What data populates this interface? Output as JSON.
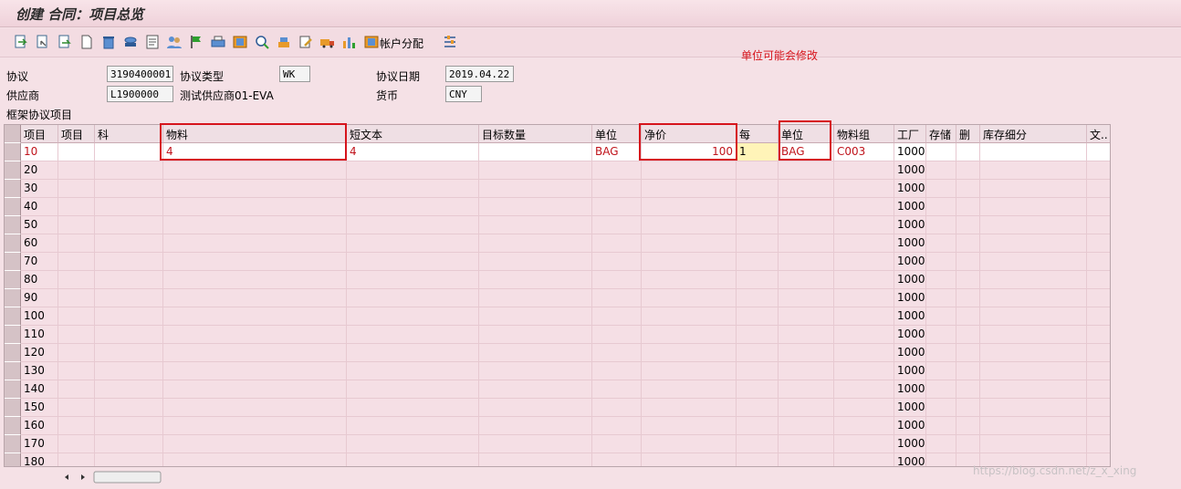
{
  "window": {
    "title": "创建 合同：项目总览"
  },
  "toolbar": {
    "icons": [
      "enter-icon",
      "copy-icon",
      "detail-icon",
      "new-item-icon",
      "delete-icon",
      "lock-icon",
      "text-icon",
      "partner-icon",
      "flag-icon",
      "print-icon",
      "config-icon",
      "search-icon",
      "stack-icon",
      "edit-icon",
      "delivery-icon",
      "chart-icon"
    ],
    "account_label": "帐户分配",
    "last_icon": "settings-icon"
  },
  "annotation": "单位可能会修改",
  "header": {
    "agreement_label": "协议",
    "agreement_value": "3190400001",
    "type_label": "协议类型",
    "type_value": "WK",
    "date_label": "协议日期",
    "date_value": "2019.04.22",
    "vendor_label": "供应商",
    "vendor_value": "L1900000",
    "vendor_name": "测试供应商01-EVA",
    "currency_label": "货币",
    "currency_value": "CNY"
  },
  "section_title": "框架协议项目",
  "table": {
    "columns": [
      "项目",
      "项目",
      "科",
      "物料",
      "短文本",
      "目标数量",
      "单位",
      "净价",
      "每",
      "单位",
      "物料组",
      "工厂",
      "存储",
      "删",
      "库存细分",
      "文.."
    ],
    "first_row": {
      "item": "10",
      "material": "4",
      "short_text": "4",
      "unit": "BAG",
      "price": "100",
      "per": "1",
      "order_unit": "BAG",
      "mat_group": "C003",
      "plant": "1000"
    },
    "rows": [
      {
        "item": "20",
        "plant": "1000"
      },
      {
        "item": "30",
        "plant": "1000"
      },
      {
        "item": "40",
        "plant": "1000"
      },
      {
        "item": "50",
        "plant": "1000"
      },
      {
        "item": "60",
        "plant": "1000"
      },
      {
        "item": "70",
        "plant": "1000"
      },
      {
        "item": "80",
        "plant": "1000"
      },
      {
        "item": "90",
        "plant": "1000"
      },
      {
        "item": "100",
        "plant": "1000"
      },
      {
        "item": "110",
        "plant": "1000"
      },
      {
        "item": "120",
        "plant": "1000"
      },
      {
        "item": "130",
        "plant": "1000"
      },
      {
        "item": "140",
        "plant": "1000"
      },
      {
        "item": "150",
        "plant": "1000"
      },
      {
        "item": "160",
        "plant": "1000"
      },
      {
        "item": "170",
        "plant": "1000"
      },
      {
        "item": "180",
        "plant": "1000"
      }
    ]
  },
  "watermark": "https://blog.csdn.net/z_x_xing"
}
